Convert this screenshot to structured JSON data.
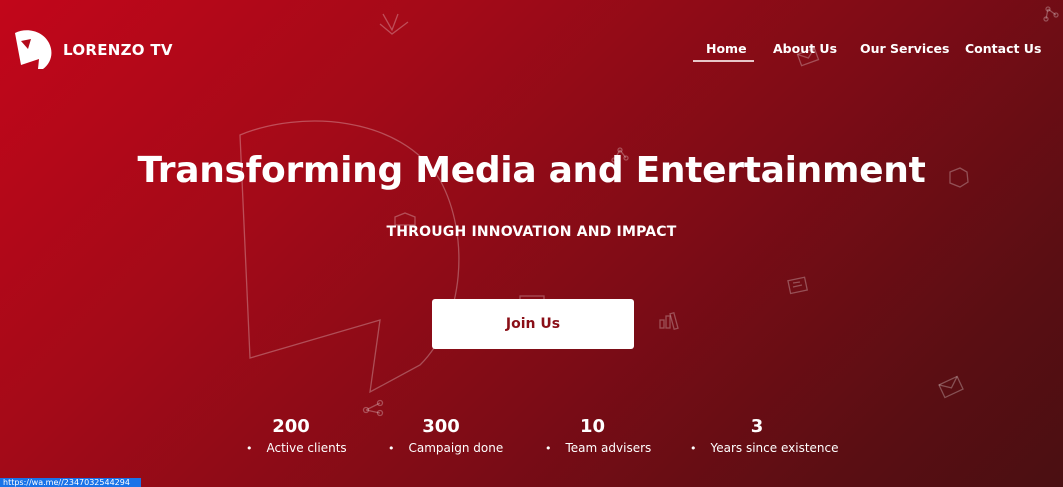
{
  "brand": {
    "name": "LORENZO TV"
  },
  "nav": {
    "home": "Home",
    "about": "About Us",
    "services": "Our Services",
    "contact": "Contact Us",
    "active": "Home"
  },
  "hero": {
    "headline": "Transforming Media and Entertainment",
    "subline": "THROUGH INNOVATION AND IMPACT",
    "cta": "Join Us"
  },
  "stats": [
    {
      "number": "200",
      "label": "Active clients"
    },
    {
      "number": "300",
      "label": "Campaign done"
    },
    {
      "number": "10",
      "label": "Team advisers"
    },
    {
      "number": "3",
      "label": "Years since existence"
    }
  ],
  "status_bar": {
    "url": "https://wa.me//2347032544294"
  },
  "colors": {
    "gradient_start": "#c2061a",
    "gradient_end": "#4a0f12",
    "button_text": "#8a0f17",
    "status_bar": "#1a73e8"
  },
  "icons": [
    "logo-icon",
    "share-icon",
    "badge-icon",
    "newspaper-icon",
    "bar-chart-icon",
    "envelope-icon",
    "checkmark-icon"
  ]
}
